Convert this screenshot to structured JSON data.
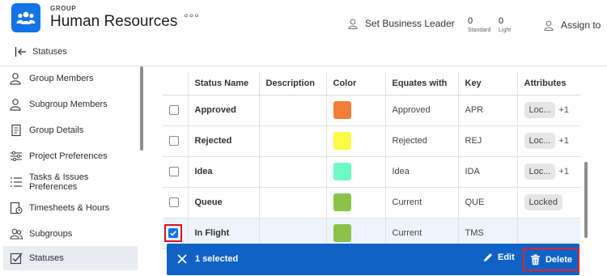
{
  "header": {
    "kicker": "GROUP",
    "title": "Human Resources",
    "more": "°°°",
    "business_leader": "Set Business Leader",
    "standard_count": "0",
    "standard_label": "Standard",
    "light_count": "0",
    "light_label": "Light",
    "assign": "Assign to"
  },
  "subheader": {
    "label": "Statuses"
  },
  "sidebar": {
    "items": [
      {
        "label": "Group Members",
        "icon": "group-members-icon"
      },
      {
        "label": "Subgroup Members",
        "icon": "subgroup-members-icon"
      },
      {
        "label": "Group Details",
        "icon": "document-icon"
      },
      {
        "label": "Project Preferences",
        "icon": "sliders-icon"
      },
      {
        "label": "Tasks & Issues Preferences",
        "icon": "list-icon"
      },
      {
        "label": "Timesheets & Hours",
        "icon": "timesheet-icon"
      },
      {
        "label": "Subgroups",
        "icon": "subgroups-icon"
      },
      {
        "label": "Statuses",
        "icon": "statuses-icon",
        "active": true
      }
    ]
  },
  "table": {
    "columns": [
      "Status Name",
      "Description",
      "Color",
      "Equates with",
      "Key",
      "Attributes"
    ],
    "rows": [
      {
        "name": "Approved",
        "description": "",
        "color": "#f47d3a",
        "equates": "Approved",
        "key": "APR",
        "attribute": "Loc...",
        "extra": "+1",
        "checked": false
      },
      {
        "name": "Rejected",
        "description": "",
        "color": "#fdfb46",
        "equates": "Rejected",
        "key": "REJ",
        "attribute": "Loc...",
        "extra": "+1",
        "checked": false
      },
      {
        "name": "Idea",
        "description": "",
        "color": "#6ffbc6",
        "equates": "Idea",
        "key": "IDA",
        "attribute": "Loc...",
        "extra": "+1",
        "checked": false
      },
      {
        "name": "Queue",
        "description": "",
        "color": "#8bc34a",
        "equates": "Current",
        "key": "QUE",
        "attribute": "Locked",
        "extra": "",
        "checked": false
      },
      {
        "name": "In Flight",
        "description": "",
        "color": "#8bc34a",
        "equates": "Current",
        "key": "TMS",
        "attribute": "",
        "extra": "",
        "checked": true
      }
    ]
  },
  "action_bar": {
    "selected_text": "1 selected",
    "edit_label": "Edit",
    "delete_label": "Delete",
    "bg_color": "#1162c6"
  }
}
